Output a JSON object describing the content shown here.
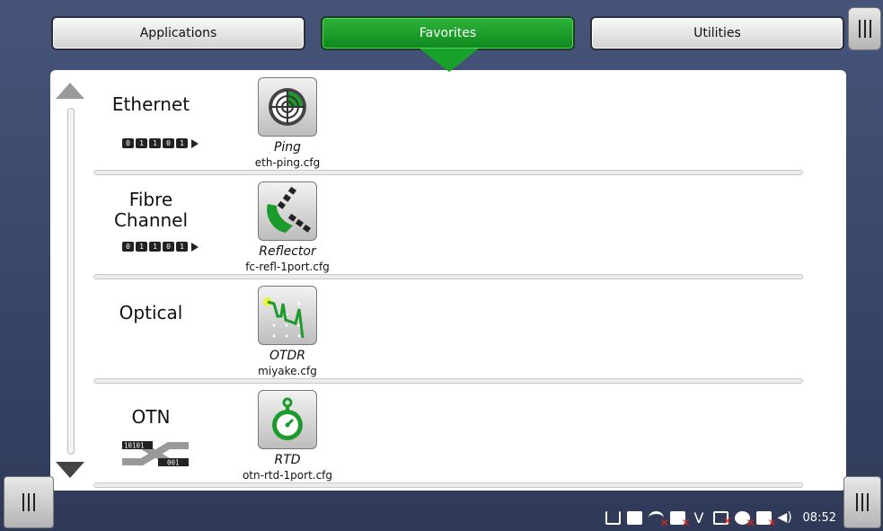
{
  "tabs": [
    {
      "label": "Applications",
      "active": false
    },
    {
      "label": "Favorites",
      "active": true
    },
    {
      "label": "Utilities",
      "active": false
    }
  ],
  "categories": [
    {
      "label": "Ethernet",
      "bits": [
        "0",
        "1",
        "1",
        "0",
        "1"
      ],
      "app": {
        "name": "Ping",
        "file": "eth-ping.cfg",
        "icon": "ping-radar-icon"
      }
    },
    {
      "label": "Fibre Channel",
      "bits": [
        "0",
        "1",
        "1",
        "0",
        "1"
      ],
      "app": {
        "name": "Reflector",
        "file": "fc-refl-1port.cfg",
        "icon": "reflector-icon"
      }
    },
    {
      "label": "Optical",
      "app": {
        "name": "OTDR",
        "file": "miyake.cfg",
        "icon": "otdr-trace-icon"
      }
    },
    {
      "label": "OTN",
      "otn_bits_left": "10101",
      "otn_bits_right": "001",
      "app": {
        "name": "RTD",
        "file": "otn-rtd-1port.cfg",
        "icon": "stopwatch-icon"
      }
    }
  ],
  "status": {
    "time": "08:52",
    "icons": [
      "power-plug-icon",
      "storage-icon",
      "wifi-off-icon",
      "bluetooth-off-icon",
      "vnc-icon",
      "terminal-off-icon",
      "satellite-off-icon",
      "network-off-icon",
      "volume-icon"
    ]
  },
  "colors": {
    "accent": "#17a329",
    "background": "#3b4868"
  }
}
